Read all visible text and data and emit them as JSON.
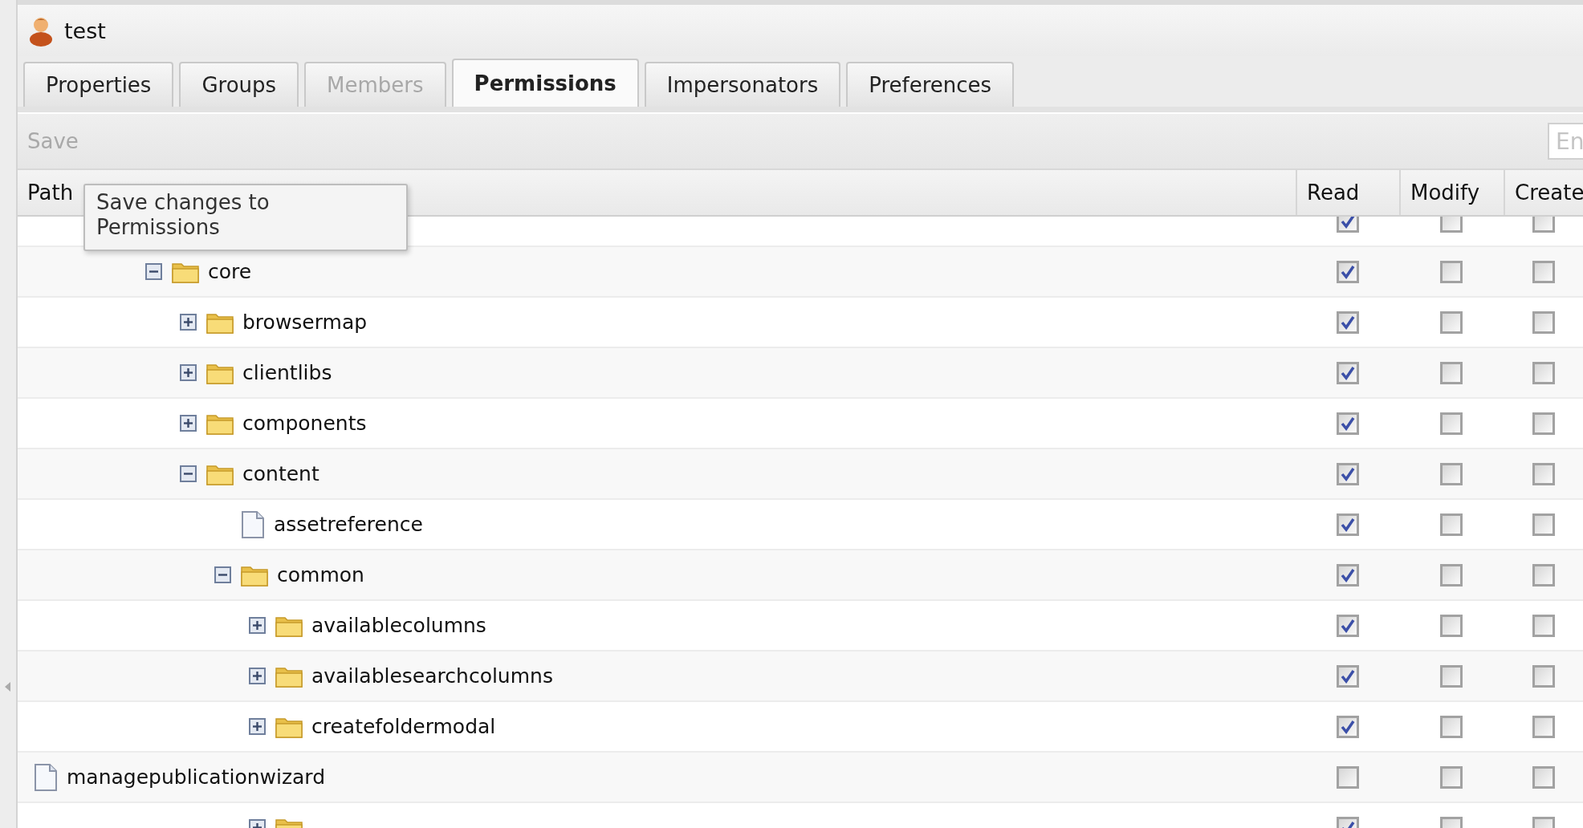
{
  "window": {
    "title": "test"
  },
  "tabs": [
    {
      "label": "Properties",
      "selected": false,
      "disabled": false
    },
    {
      "label": "Groups",
      "selected": false,
      "disabled": false
    },
    {
      "label": "Members",
      "selected": false,
      "disabled": true
    },
    {
      "label": "Permissions",
      "selected": true,
      "disabled": false
    },
    {
      "label": "Impersonators",
      "selected": false,
      "disabled": false
    },
    {
      "label": "Preferences",
      "selected": false,
      "disabled": false
    }
  ],
  "toolbar": {
    "save": {
      "label": "Save",
      "disabled": true
    },
    "search": {
      "placeholder": "En"
    }
  },
  "tooltip": "Save changes to Permissions",
  "table": {
    "columns": [
      "Path",
      "Read",
      "Modify",
      "Create"
    ],
    "tree": [
      {
        "children": [
          {
            "children": [
              {
                "children": [
                  {
                    "kind": "row",
                    "checks": [
                      {
                        "checked": true
                      },
                      {
                        "checked": false
                      },
                      {
                        "checked": false
                      }
                    ],
                    "children": [
                      {
                        "kind": "folder",
                        "label": "core",
                        "expanded": true,
                        "checks": [
                          {
                            "checked": true
                          },
                          {
                            "checked": false
                          },
                          {
                            "checked": false
                          }
                        ],
                        "children": [
                          {
                            "kind": "folder",
                            "label": "browsermap",
                            "expanded": false,
                            "checks": [
                              {
                                "checked": true
                              },
                              {
                                "checked": false
                              },
                              {
                                "checked": false
                              }
                            ]
                          },
                          {
                            "kind": "folder",
                            "label": "clientlibs",
                            "expanded": false,
                            "checks": [
                              {
                                "checked": true
                              },
                              {
                                "checked": false
                              },
                              {
                                "checked": false
                              }
                            ]
                          },
                          {
                            "kind": "folder",
                            "label": "components",
                            "expanded": false,
                            "checks": [
                              {
                                "checked": true
                              },
                              {
                                "checked": false
                              },
                              {
                                "checked": false
                              }
                            ]
                          },
                          {
                            "kind": "folder",
                            "label": "content",
                            "expanded": true,
                            "checks": [
                              {
                                "checked": true
                              },
                              {
                                "checked": false
                              },
                              {
                                "checked": false
                              }
                            ],
                            "children": [
                              {
                                "kind": "file",
                                "label": "assetreference",
                                "checks": [
                                  {
                                    "checked": true
                                  },
                                  {
                                    "checked": false
                                  },
                                  {
                                    "checked": false
                                  }
                                ]
                              },
                              {
                                "kind": "folder",
                                "label": "common",
                                "expanded": true,
                                "checks": [
                                  {
                                    "checked": true
                                  },
                                  {
                                    "checked": false
                                  },
                                  {
                                    "checked": false
                                  }
                                ],
                                "children": [
                                  {
                                    "kind": "folder",
                                    "label": "availablecolumns",
                                    "expanded": false,
                                    "checks": [
                                      {
                                        "checked": true
                                      },
                                      {
                                        "checked": false
                                      },
                                      {
                                        "checked": false
                                      }
                                    ]
                                  },
                                  {
                                    "kind": "folder",
                                    "label": "availablesearchcolumns",
                                    "expanded": false,
                                    "checks": [
                                      {
                                        "checked": true
                                      },
                                      {
                                        "checked": false
                                      },
                                      {
                                        "checked": false
                                      }
                                    ]
                                  },
                                  {
                                    "kind": "folder",
                                    "label": "createfoldermodal",
                                    "expanded": false,
                                    "checks": [
                                      {
                                        "checked": true
                                      },
                                      {
                                        "checked": false
                                      },
                                      {
                                        "checked": false
                                      }
                                    ]
                                  }
                                ]
                              }
                            ]
                          }
                        ]
                      }
                    ]
                  }
                ]
              }
            ]
          }
        ]
      },
      {
        "kind": "file",
        "label": "managepublicationwizard",
        "checks": [
          {
            "checked": false
          },
          {
            "checked": false
          },
          {
            "checked": false
          }
        ]
      },
      {
        "children": [
          {
            "children": [
              {
                "children": [
                  {
                    "children": [
                      {
                        "children": [
                          {
                            "children": [
                              {
                                "children": [
                                  {
                                    "kind": "folder",
                                    "expanded": false,
                                    "checks": [
                                      {
                                        "checked": true
                                      },
                                      {
                                        "checked": false
                                      },
                                      {
                                        "checked": false
                                      }
                                    ]
                                  }
                                ]
                              }
                            ]
                          }
                        ]
                      }
                    ]
                  }
                ]
              }
            ]
          }
        ]
      }
    ]
  }
}
